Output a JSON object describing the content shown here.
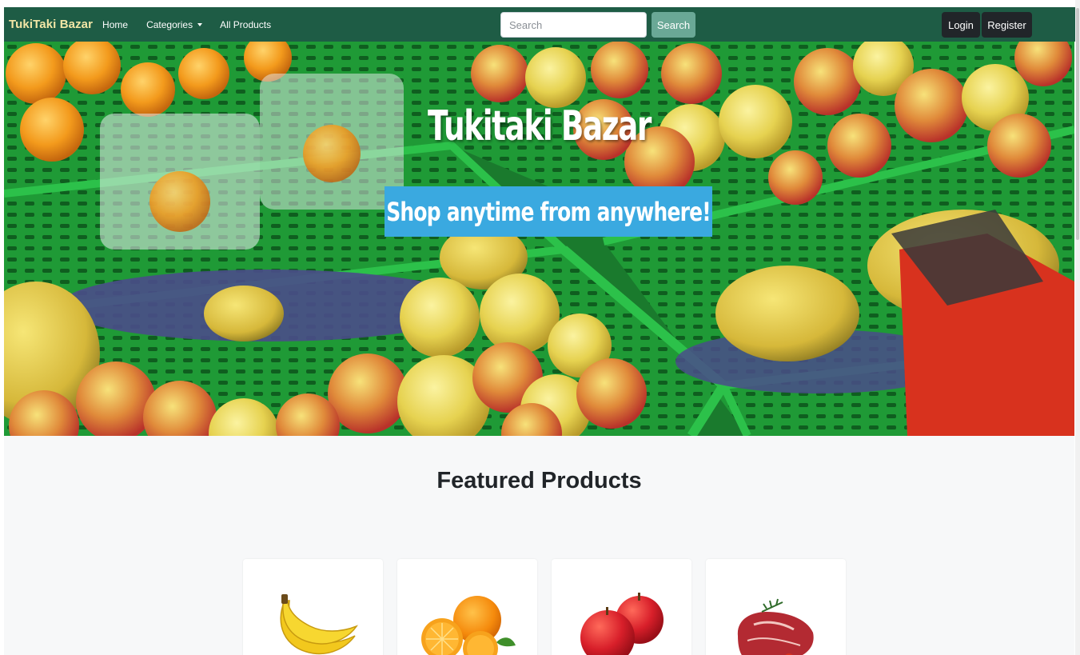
{
  "navbar": {
    "brand": "TukiTaki Bazar",
    "links": [
      "Home",
      "Categories",
      "All Products"
    ],
    "search_placeholder": "Search",
    "search_button": "Search",
    "login": "Login",
    "register": "Register",
    "background_color": "#1e5c45"
  },
  "hero": {
    "title": "Tukitaki Bazar",
    "tagline": "Shop anytime from anywhere!",
    "tagline_color": "#3aa9e0"
  },
  "featured": {
    "title": "Featured Products",
    "products": [
      {
        "icon": "banana-icon"
      },
      {
        "icon": "orange-icon"
      },
      {
        "icon": "apple-icon"
      },
      {
        "icon": "meat-icon"
      }
    ]
  }
}
